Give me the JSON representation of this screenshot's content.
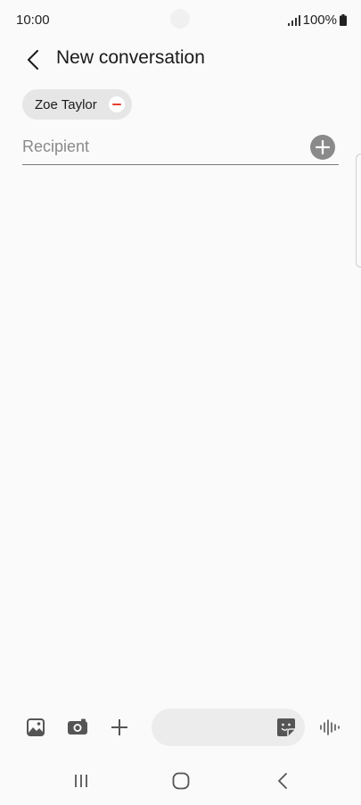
{
  "status_bar": {
    "time": "10:00",
    "battery": "100%"
  },
  "header": {
    "title": "New conversation"
  },
  "recipients": {
    "chips": [
      {
        "name": "Zoe Taylor"
      }
    ],
    "placeholder": "Recipient"
  },
  "composer": {
    "message_placeholder": ""
  },
  "icons": {
    "back": "chevron-left-icon",
    "remove": "minus-circle-icon",
    "add": "plus-circle-icon",
    "gallery": "image-icon",
    "camera": "camera-icon",
    "more": "plus-icon",
    "sticker": "sticker-icon",
    "voice": "voice-wave-icon"
  },
  "colors": {
    "remove_accent": "#e8402e",
    "background": "#fafafa"
  }
}
